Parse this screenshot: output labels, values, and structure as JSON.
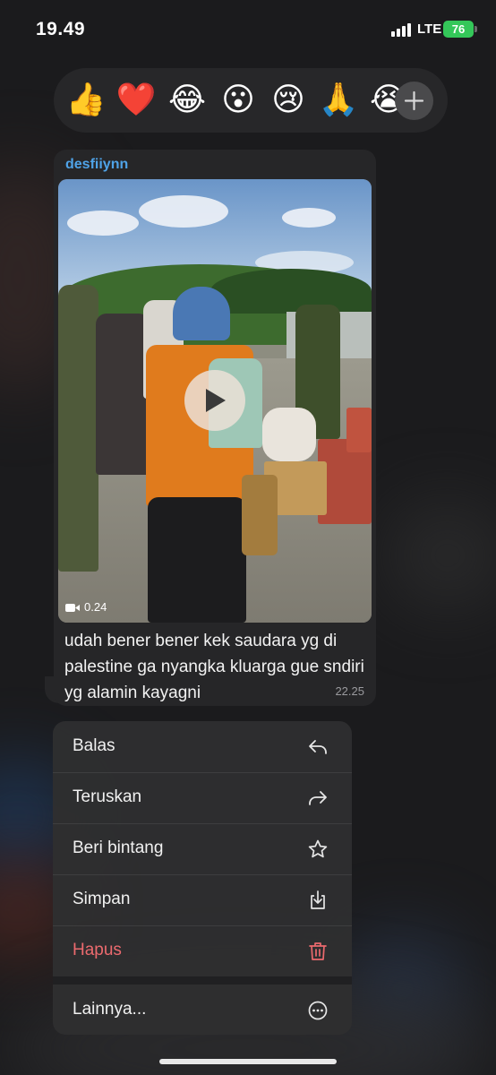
{
  "status_bar": {
    "time": "19.49",
    "network": "LTE",
    "battery": "76"
  },
  "reactions": {
    "emojis": [
      {
        "char": "👍",
        "name": "thumbs-up"
      },
      {
        "char": "❤️",
        "name": "red-heart"
      },
      {
        "char": "😂",
        "name": "tears-of-joy"
      },
      {
        "char": "😮",
        "name": "open-mouth"
      },
      {
        "char": "😢",
        "name": "crying"
      },
      {
        "char": "🙏",
        "name": "folded-hands"
      },
      {
        "char": "😭",
        "name": "loudly-crying"
      }
    ],
    "more_icon": "plus-icon"
  },
  "message": {
    "sender": "desfiiynn",
    "video_duration": "0.24",
    "text": "udah bener bener kek saudara yg di palestine ga nyangka kluarga gue sndiri yg alamin kayagni",
    "time": "22.25"
  },
  "menu": {
    "items": [
      {
        "label": "Balas",
        "icon": "reply-icon"
      },
      {
        "label": "Teruskan",
        "icon": "forward-icon"
      },
      {
        "label": "Beri bintang",
        "icon": "star-icon"
      },
      {
        "label": "Simpan",
        "icon": "save-icon"
      },
      {
        "label": "Hapus",
        "icon": "trash-icon"
      },
      {
        "label": "Lainnya...",
        "icon": "more-icon"
      }
    ]
  },
  "colors": {
    "sender_name": "#4fa3e8",
    "delete": "#eb6a6e",
    "battery": "#34c759"
  }
}
